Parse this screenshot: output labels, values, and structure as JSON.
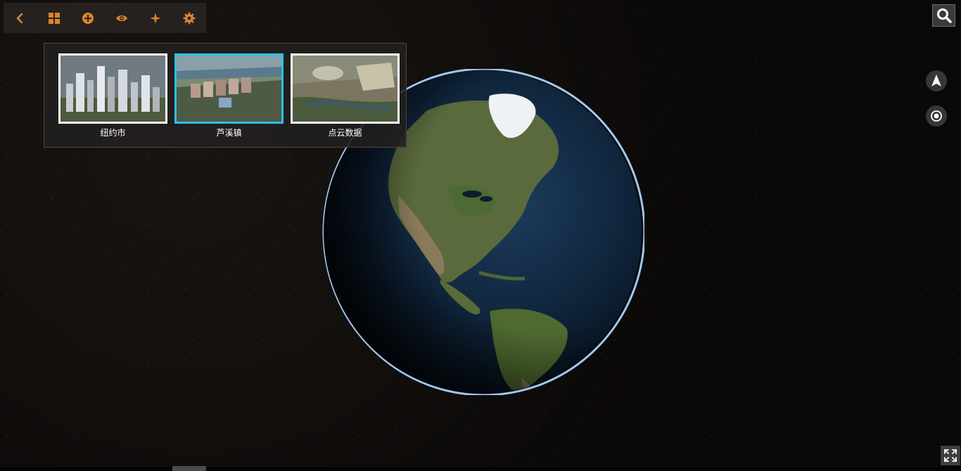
{
  "toolbar": {
    "buttons": [
      {
        "icon": "chevron-left-icon",
        "color": "#e0822e"
      },
      {
        "icon": "grid-icon",
        "color": "#e0822e"
      },
      {
        "icon": "plus-circle-icon",
        "color": "#e0822e"
      },
      {
        "icon": "eye-icon",
        "color": "#e0822e"
      },
      {
        "icon": "sparkle-icon",
        "color": "#e0822e"
      },
      {
        "icon": "gear-icon",
        "color": "#e0822e"
      }
    ]
  },
  "scenes": [
    {
      "label": "纽约市",
      "selected": false
    },
    {
      "label": "芦溪镇",
      "selected": true
    },
    {
      "label": "点云数据",
      "selected": false
    }
  ],
  "colors": {
    "accent": "#e0822e",
    "selected_border": "#2bc0ec",
    "panel_bg": "#22201f"
  },
  "controls": {
    "search_icon": "search-icon",
    "compass_icon": "compass-arrow-icon",
    "locate_icon": "locate-icon",
    "fullscreen_icon": "fullscreen-icon"
  }
}
